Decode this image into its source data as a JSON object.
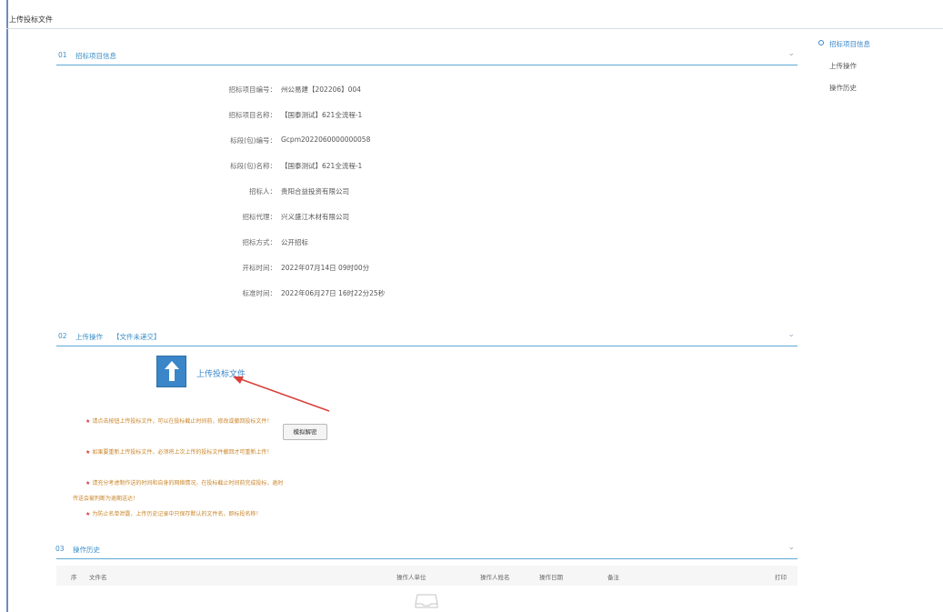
{
  "header": {
    "title": "上传投标文件"
  },
  "section1": {
    "num": "01",
    "label": "招标项目信息",
    "fields": [
      {
        "key": "招标项目编号：",
        "value": "州公易建【202206】004"
      },
      {
        "key": "招标项目名称：",
        "value": "【国泰测试】621全流程-1"
      },
      {
        "key": "标段(包)编号：",
        "value": "Gcpm2022060000000058"
      },
      {
        "key": "标段(包)名称：",
        "value": "【国泰测试】621全流程-1"
      },
      {
        "key": "招标人：",
        "value": "贵阳合益投资有限公司"
      },
      {
        "key": "招标代理：",
        "value": "兴义盛江木材有限公司"
      },
      {
        "key": "招标方式：",
        "value": "公开招标"
      },
      {
        "key": "开标时间：",
        "value": "2022年07月14日 09时00分"
      },
      {
        "key": "标准时间：",
        "value": "2022年06月27日 16时22分25秒"
      }
    ]
  },
  "section2": {
    "num": "02",
    "label": "上传操作",
    "status": "【文件未递交】",
    "upload_label": "上传投标文件",
    "simulate_button": "模拟解密",
    "notes": [
      "请点击按钮上传投标文件，可以在投标截止时间前，修改或撤回投标文件！",
      "如果要重新上传投标文件，必须将上次上传的投标文件撤回才可重新上传！",
      "请充分考虑制作送的时间和自身的网络情况，在投标截止时间前完成投标，逾时传送会被判断为逾期送达！",
      "为防止名单泄露，上传历史记录中只保存默认的文件名，即标段名称！"
    ]
  },
  "section3": {
    "num": "03",
    "label": "操作历史",
    "columns": [
      "序",
      "文件名",
      "操作人单位",
      "操作人姓名",
      "操作日期",
      "备注",
      "打印"
    ]
  },
  "side_nav": {
    "items": [
      "招标项目信息",
      "上传操作",
      "操作历史"
    ]
  },
  "colors": {
    "accent": "#3a86c8",
    "note": "#c9852a",
    "star": "#d43b3b"
  },
  "icons": {
    "upload": "upload-arrow-icon",
    "collapse": "chevron-down-icon",
    "empty": "empty-tray-icon"
  }
}
